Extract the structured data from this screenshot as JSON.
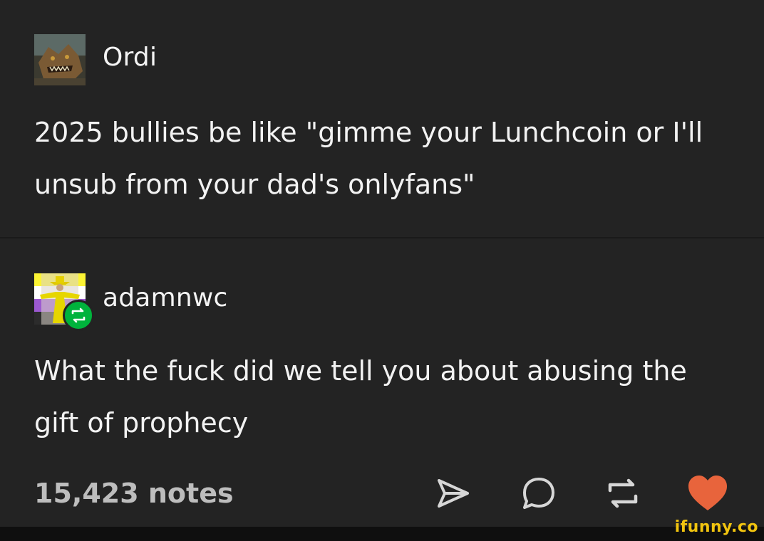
{
  "posts": [
    {
      "username": "Ordi",
      "text": "2025 bullies be like \"gimme your Lunchcoin or I'll unsub from your dad's onlyfans\""
    },
    {
      "username": "adamnwc",
      "text": "What the fuck did we tell you about abusing the gift of prophecy"
    }
  ],
  "footer": {
    "notes": "15,423 notes"
  },
  "colors": {
    "background": "#232323",
    "reblog_green": "#00b33c",
    "like_heart": "#e8643c",
    "watermark": "#f1c40f"
  },
  "watermark": "ifunny.co"
}
